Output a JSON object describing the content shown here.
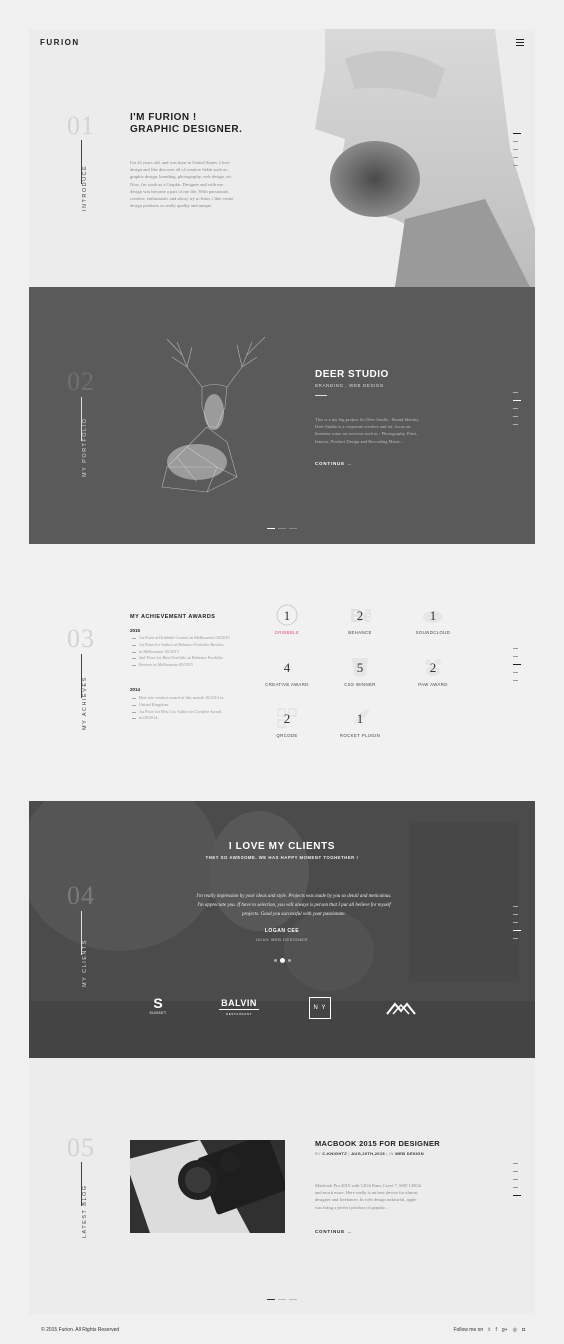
{
  "header": {
    "logo": "FURION"
  },
  "intro": {
    "number": "01",
    "label": "INTRODUCE",
    "heading_line1": "I'M FURION !",
    "heading_line2": "GRAPHIC DESIGNER.",
    "paragraph": [
      "I'm 24 years old, and was born in United States. I love",
      "design and like discover all of creative fields such as :",
      "graphic design, branding, photography, web design, etc.",
      "Now, i'm work as a Graphic Designer and with me.",
      "design was become a part of my life. With passionate,",
      "creative, enthusiastic and alway try to learn, i like create",
      "design products so really quality and unique."
    ]
  },
  "portfolio": {
    "number": "02",
    "label": "MY PORTFOLIO",
    "title": "DEER STUDIO",
    "subtitle": "BRANDING , WEB DESIGN",
    "paragraph": [
      "This is a my big project for Deer Studio - Brand Identity.",
      "Deer Studio is a corporate creative and art, focus on",
      "business some art services such as : Photography, Print,",
      "Interior, Product Design and Recording Music..."
    ],
    "continue": "CONTINUE"
  },
  "achieves": {
    "number": "03",
    "label": "MY ACHIEVES",
    "title": "MY ACHIEVEMENT AWARDS",
    "year1": "2015",
    "list1": [
      "1st Prize at Dribbble Contest in Melbourner 04/2015",
      "1st Prize for Author at Behance Portfolio Review",
      "in Melbourner 05/2015",
      "2nd Prize for Best Portfolio at Behance Portfolio",
      "Review in Melbourner 05/2015"
    ],
    "year2": "2014",
    "list2": [
      "Best site creative award of this month 10/2014 in",
      "United Kingdom.",
      "1st Prize for Best Css Author in Creative Award",
      "in 08/2014."
    ],
    "awards": [
      {
        "count": "1",
        "label": "DRIBBBLE",
        "icon": "dribbble-icon",
        "color": "#ea4c89"
      },
      {
        "count": "2",
        "label": "BEHANCE",
        "icon": "behance-icon",
        "color": "#444444"
      },
      {
        "count": "1",
        "label": "SOUNDCLOUD",
        "icon": "soundcloud-icon",
        "color": "#444444"
      },
      {
        "count": "4",
        "label": "CREATIVE AWARD",
        "icon": "creative-award-icon",
        "color": "#444444"
      },
      {
        "count": "5",
        "label": "CSS WINNER",
        "icon": "css-winner-icon",
        "color": "#444444"
      },
      {
        "count": "2",
        "label": "PAW AWARD",
        "icon": "paw-icon",
        "color": "#444444"
      },
      {
        "count": "2",
        "label": "QRCODE",
        "icon": "qrcode-icon",
        "color": "#444444"
      },
      {
        "count": "1",
        "label": "ROCKET PLUGIN",
        "icon": "rocket-icon",
        "color": "#444444"
      }
    ]
  },
  "clients": {
    "number": "04",
    "label": "MY CLIENTS",
    "title": "I LOVE MY CLIENTS",
    "subtitle": "THEY SO AWESOME. WE HAS HAPPY MOMENT TOGHETHER !",
    "quote_line1": "I'm really impression by your ideas and style. Projects was made by you so detail and meticulous.",
    "quote_line2": "I'm appreciate you. If have to selection, you will always is person that I put all believe for myself",
    "quote_line3": "projects. Good you successful with your passionate.",
    "author": "LOGAN CEE",
    "role": "UI/UX WEB DESIGNER",
    "brands": {
      "sunset_letter": "S",
      "sunset_name": "SUNSET",
      "balvin_name": "BALVIN",
      "balvin_sub": "RESTAURANT",
      "ny": "N Y"
    }
  },
  "blog": {
    "number": "05",
    "label": "LATEST BLOG",
    "title": "MACBOOK 2015 FOR DESIGNER",
    "meta_by": "BY",
    "meta_author": "C-KNIGHTZ",
    "meta_date": "AUG,20TH,2015",
    "meta_in": "IN",
    "meta_category": "WEB DESIGN",
    "paragraph": [
      "Macbook Pro 2015 with 12Gb Ram, Corei 7, SSD 128Gb",
      "and much more. Here really is an best device for almost",
      "designer and freelancer. In web design industrial, apple",
      "was bring a perfect product of graphic..."
    ],
    "continue": "CONTINUE"
  },
  "footer": {
    "copyright": "© 2015 Furion. All Rights Reserved",
    "follow": "Follow me on",
    "social": [
      "twitter-icon",
      "facebook-icon",
      "googleplus-icon",
      "dribbble-icon",
      "instagram-icon"
    ]
  }
}
